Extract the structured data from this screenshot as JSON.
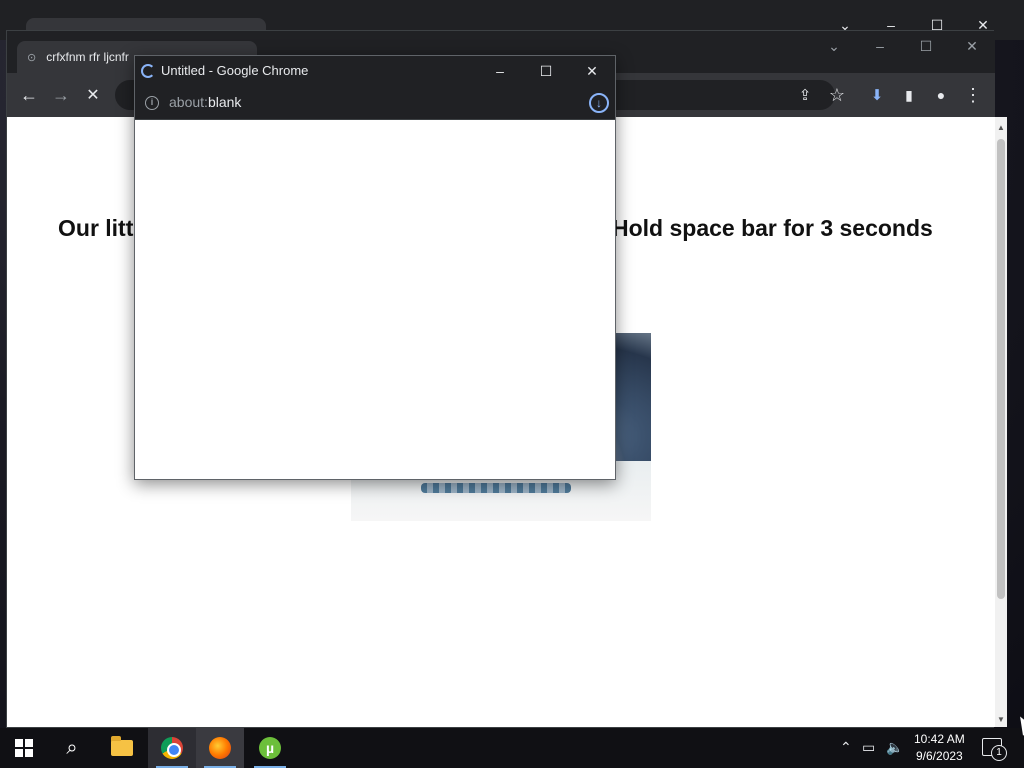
{
  "background_window": {
    "controls": [
      "chevron-down",
      "minimize",
      "maximize",
      "close"
    ]
  },
  "browser": {
    "tabs": [
      {
        "label": "crfxfnm rfr ljcnfr",
        "active": true
      },
      {
        "label": "",
        "active": false
      }
    ],
    "toolbar": {
      "back": "←",
      "forward": "→",
      "stop": "✕",
      "share": "⇪",
      "bookmark": "☆",
      "download": "⬇",
      "side_panel": "▮",
      "profile": "●",
      "menu": "⋮"
    },
    "window_controls": {
      "tab_search": "⌄",
      "minimize": "–",
      "maximize": "☐",
      "close": "✕"
    },
    "page": {
      "heading_left": "Our litt",
      "heading_right": "Hold space bar for 3 seconds",
      "subheading": ")"
    }
  },
  "popup": {
    "title": "Untitled - Google Chrome",
    "url_scheme": "about:",
    "url_host": "blank",
    "controls": {
      "minimize": "–",
      "maximize": "☐",
      "close": "✕"
    }
  },
  "taskbar": {
    "apps": [
      "start",
      "search",
      "file-explorer",
      "chrome",
      "firefox",
      "utorrent"
    ],
    "clock": {
      "time": "10:42 AM",
      "date": "9/6/2023"
    },
    "notifications": "1"
  },
  "colors": {
    "chrome_dark": "#202124",
    "toolbar": "#35363a",
    "accent": "#8ab4f8"
  }
}
